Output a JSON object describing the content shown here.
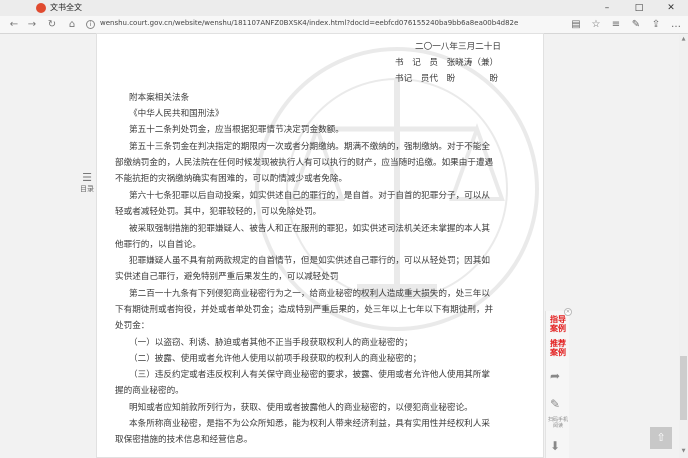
{
  "browser": {
    "tab_title": "文书全文",
    "address": "wenshu.court.gov.cn/website/wenshu/181107ANFZ0BXSK4/index.html?docId=eebfcd076155240ba9bb6a8ea00b4d82e",
    "colors": {
      "favicon": "#e04a2f"
    }
  },
  "doc": {
    "date": "二〇一八年三月二十日",
    "clerk1": "书　记　员　张晓涛（兼）",
    "clerk2": "书记　员代　盼　　　　盼",
    "heading": "附本案相关法条",
    "law_name": "《中华人民共和国刑法》",
    "lines": [
      "第五十二条判处罚金，应当根据犯罪情节决定罚金数额。",
      "第五十三条罚金在判决指定的期限内一次或者分期缴纳。期满不缴纳的，强制缴纳。对于不能全",
      "部缴纳罚金的，人民法院在任何时候发现被执行人有可以执行的财产，应当随时追缴。如果由于遭遇",
      "不能抗拒的灾祸缴纳确实有困难的，可以酌情减少或者免除。",
      "第六十七条犯罪以后自动投案，如实供述自己的罪行的，是自首。对于自首的犯罪分子，可以从",
      "轻或者减轻处罚。其中，犯罪较轻的，可以免除处罚。",
      "被采取强制措施的犯罪嫌疑人、被告人和正在服刑的罪犯，如实供述司法机关还未掌握的本人其",
      "他罪行的，以自首论。",
      "犯罪嫌疑人虽不具有前两款规定的自首情节，但是如实供述自己罪行的，可以从轻处罚；因其如",
      "实供述自己罪行，避免特别严重后果发生的，可以减轻处罚",
      "第二百一十九条有下列侵犯商业秘密行为之一，给商业秘密的权利人造成重大损失的，处三年以",
      "下有期徒刑或者拘役，并处或者单处罚金；造成特别严重后果的，处三年以上七年以下有期徒刑，并",
      "处罚金：",
      "（一）以盗窃、利诱、胁迫或者其他不正当手段获取权利人的商业秘密的；",
      "（二）披露、使用或者允许他人使用以前项手段获取的权利人的商业秘密的；",
      "（三）违反约定或者违反权利人有关保守商业秘密的要求，披露、使用或者允许他人使用其所掌",
      "握的商业秘密的。",
      "明知或者应知前款所列行为，获取、使用或者披露他人的商业秘密的，以侵犯商业秘密论。",
      "本条所称商业秘密，是指不为公众所知悉，能为权利人带来经济利益，具有实用性并经权利人采",
      "取保密措施的技术信息和经营信息。"
    ]
  },
  "toc": {
    "icon": "list-icon",
    "label": "目录"
  },
  "sidebar": {
    "item1": "指导案例",
    "item2": "推荐案例",
    "share_icon": "share-icon",
    "edit_icon": "edit-icon",
    "small_label": "扫码手机阅读",
    "colors": {
      "accent": "#e32020"
    }
  },
  "totop": {
    "icon": "arrow-up-icon"
  }
}
